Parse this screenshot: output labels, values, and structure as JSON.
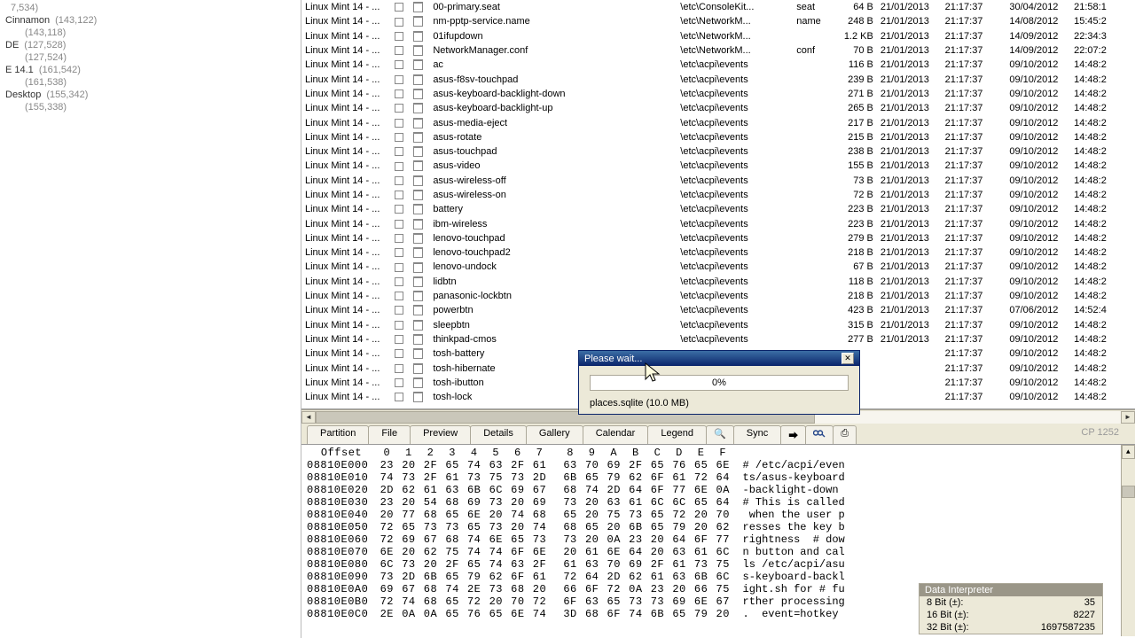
{
  "sidebar": {
    "items": [
      {
        "label": "",
        "count": "7,534)"
      },
      {
        "label": "Cinnamon",
        "count": "(143,122)"
      },
      {
        "label": "",
        "count": "(143,118)",
        "indent": true
      },
      {
        "label": "DE",
        "count": "(127,528)"
      },
      {
        "label": "",
        "count": "(127,524)",
        "indent": true
      },
      {
        "label": "E 14.1",
        "count": "(161,542)"
      },
      {
        "label": "",
        "count": "(161,538)",
        "indent": true
      },
      {
        "label": "Desktop",
        "count": "(155,342)"
      },
      {
        "label": "",
        "count": "(155,338)",
        "indent": true
      }
    ]
  },
  "grid": {
    "rows": [
      {
        "desc": "Linux Mint 14 - ...",
        "name": "00-primary.seat",
        "path": "\\etc\\ConsoleKit...",
        "ext": "seat",
        "size": "64 B",
        "d1": "21/01/2013",
        "t1": "21:17:37",
        "d2": "30/04/2012",
        "t2": "21:58:1"
      },
      {
        "desc": "Linux Mint 14 - ...",
        "name": "nm-pptp-service.name",
        "path": "\\etc\\NetworkM...",
        "ext": "name",
        "size": "248 B",
        "d1": "21/01/2013",
        "t1": "21:17:37",
        "d2": "14/08/2012",
        "t2": "15:45:2"
      },
      {
        "desc": "Linux Mint 14 - ...",
        "name": "01ifupdown",
        "path": "\\etc\\NetworkM...",
        "ext": "",
        "size": "1.2 KB",
        "d1": "21/01/2013",
        "t1": "21:17:37",
        "d2": "14/09/2012",
        "t2": "22:34:3"
      },
      {
        "desc": "Linux Mint 14 - ...",
        "name": "NetworkManager.conf",
        "path": "\\etc\\NetworkM...",
        "ext": "conf",
        "size": "70 B",
        "d1": "21/01/2013",
        "t1": "21:17:37",
        "d2": "14/09/2012",
        "t2": "22:07:2"
      },
      {
        "desc": "Linux Mint 14 - ...",
        "name": "ac",
        "path": "\\etc\\acpi\\events",
        "ext": "",
        "size": "116 B",
        "d1": "21/01/2013",
        "t1": "21:17:37",
        "d2": "09/10/2012",
        "t2": "14:48:2"
      },
      {
        "desc": "Linux Mint 14 - ...",
        "name": "asus-f8sv-touchpad",
        "path": "\\etc\\acpi\\events",
        "ext": "",
        "size": "239 B",
        "d1": "21/01/2013",
        "t1": "21:17:37",
        "d2": "09/10/2012",
        "t2": "14:48:2"
      },
      {
        "desc": "Linux Mint 14 - ...",
        "name": "asus-keyboard-backlight-down",
        "path": "\\etc\\acpi\\events",
        "ext": "",
        "size": "271 B",
        "d1": "21/01/2013",
        "t1": "21:17:37",
        "d2": "09/10/2012",
        "t2": "14:48:2"
      },
      {
        "desc": "Linux Mint 14 - ...",
        "name": "asus-keyboard-backlight-up",
        "path": "\\etc\\acpi\\events",
        "ext": "",
        "size": "265 B",
        "d1": "21/01/2013",
        "t1": "21:17:37",
        "d2": "09/10/2012",
        "t2": "14:48:2"
      },
      {
        "desc": "Linux Mint 14 - ...",
        "name": "asus-media-eject",
        "path": "\\etc\\acpi\\events",
        "ext": "",
        "size": "217 B",
        "d1": "21/01/2013",
        "t1": "21:17:37",
        "d2": "09/10/2012",
        "t2": "14:48:2"
      },
      {
        "desc": "Linux Mint 14 - ...",
        "name": "asus-rotate",
        "path": "\\etc\\acpi\\events",
        "ext": "",
        "size": "215 B",
        "d1": "21/01/2013",
        "t1": "21:17:37",
        "d2": "09/10/2012",
        "t2": "14:48:2"
      },
      {
        "desc": "Linux Mint 14 - ...",
        "name": "asus-touchpad",
        "path": "\\etc\\acpi\\events",
        "ext": "",
        "size": "238 B",
        "d1": "21/01/2013",
        "t1": "21:17:37",
        "d2": "09/10/2012",
        "t2": "14:48:2"
      },
      {
        "desc": "Linux Mint 14 - ...",
        "name": "asus-video",
        "path": "\\etc\\acpi\\events",
        "ext": "",
        "size": "155 B",
        "d1": "21/01/2013",
        "t1": "21:17:37",
        "d2": "09/10/2012",
        "t2": "14:48:2"
      },
      {
        "desc": "Linux Mint 14 - ...",
        "name": "asus-wireless-off",
        "path": "\\etc\\acpi\\events",
        "ext": "",
        "size": "73 B",
        "d1": "21/01/2013",
        "t1": "21:17:37",
        "d2": "09/10/2012",
        "t2": "14:48:2"
      },
      {
        "desc": "Linux Mint 14 - ...",
        "name": "asus-wireless-on",
        "path": "\\etc\\acpi\\events",
        "ext": "",
        "size": "72 B",
        "d1": "21/01/2013",
        "t1": "21:17:37",
        "d2": "09/10/2012",
        "t2": "14:48:2"
      },
      {
        "desc": "Linux Mint 14 - ...",
        "name": "battery",
        "path": "\\etc\\acpi\\events",
        "ext": "",
        "size": "223 B",
        "d1": "21/01/2013",
        "t1": "21:17:37",
        "d2": "09/10/2012",
        "t2": "14:48:2"
      },
      {
        "desc": "Linux Mint 14 - ...",
        "name": "ibm-wireless",
        "path": "\\etc\\acpi\\events",
        "ext": "",
        "size": "223 B",
        "d1": "21/01/2013",
        "t1": "21:17:37",
        "d2": "09/10/2012",
        "t2": "14:48:2"
      },
      {
        "desc": "Linux Mint 14 - ...",
        "name": "lenovo-touchpad",
        "path": "\\etc\\acpi\\events",
        "ext": "",
        "size": "279 B",
        "d1": "21/01/2013",
        "t1": "21:17:37",
        "d2": "09/10/2012",
        "t2": "14:48:2"
      },
      {
        "desc": "Linux Mint 14 - ...",
        "name": "lenovo-touchpad2",
        "path": "\\etc\\acpi\\events",
        "ext": "",
        "size": "218 B",
        "d1": "21/01/2013",
        "t1": "21:17:37",
        "d2": "09/10/2012",
        "t2": "14:48:2"
      },
      {
        "desc": "Linux Mint 14 - ...",
        "name": "lenovo-undock",
        "path": "\\etc\\acpi\\events",
        "ext": "",
        "size": "67 B",
        "d1": "21/01/2013",
        "t1": "21:17:37",
        "d2": "09/10/2012",
        "t2": "14:48:2"
      },
      {
        "desc": "Linux Mint 14 - ...",
        "name": "lidbtn",
        "path": "\\etc\\acpi\\events",
        "ext": "",
        "size": "118 B",
        "d1": "21/01/2013",
        "t1": "21:17:37",
        "d2": "09/10/2012",
        "t2": "14:48:2"
      },
      {
        "desc": "Linux Mint 14 - ...",
        "name": "panasonic-lockbtn",
        "path": "\\etc\\acpi\\events",
        "ext": "",
        "size": "218 B",
        "d1": "21/01/2013",
        "t1": "21:17:37",
        "d2": "09/10/2012",
        "t2": "14:48:2"
      },
      {
        "desc": "Linux Mint 14 - ...",
        "name": "powerbtn",
        "path": "\\etc\\acpi\\events",
        "ext": "",
        "size": "423 B",
        "d1": "21/01/2013",
        "t1": "21:17:37",
        "d2": "07/06/2012",
        "t2": "14:52:4"
      },
      {
        "desc": "Linux Mint 14 - ...",
        "name": "sleepbtn",
        "path": "\\etc\\acpi\\events",
        "ext": "",
        "size": "315 B",
        "d1": "21/01/2013",
        "t1": "21:17:37",
        "d2": "09/10/2012",
        "t2": "14:48:2"
      },
      {
        "desc": "Linux Mint 14 - ...",
        "name": "thinkpad-cmos",
        "path": "\\etc\\acpi\\events",
        "ext": "",
        "size": "277 B",
        "d1": "21/01/2013",
        "t1": "21:17:37",
        "d2": "09/10/2012",
        "t2": "14:48:2"
      },
      {
        "desc": "Linux Mint 14 - ...",
        "name": "tosh-battery",
        "path": "",
        "ext": "",
        "size": "",
        "d1": "",
        "t1": "21:17:37",
        "d2": "09/10/2012",
        "t2": "14:48:2"
      },
      {
        "desc": "Linux Mint 14 - ...",
        "name": "tosh-hibernate",
        "path": "",
        "ext": "",
        "size": "",
        "d1": "",
        "t1": "21:17:37",
        "d2": "09/10/2012",
        "t2": "14:48:2"
      },
      {
        "desc": "Linux Mint 14 - ...",
        "name": "tosh-ibutton",
        "path": "",
        "ext": "",
        "size": "",
        "d1": "",
        "t1": "21:17:37",
        "d2": "09/10/2012",
        "t2": "14:48:2"
      },
      {
        "desc": "Linux Mint 14 - ...",
        "name": "tosh-lock",
        "path": "",
        "ext": "",
        "size": "",
        "d1": "",
        "t1": "21:17:37",
        "d2": "09/10/2012",
        "t2": "14:48:2"
      }
    ]
  },
  "tabs": {
    "items": [
      "Partition",
      "File",
      "Preview",
      "Details",
      "Gallery",
      "Calendar",
      "Legend"
    ],
    "sync_label": "Sync",
    "codepage": "CP 1252"
  },
  "hex": {
    "header_offset": "Offset",
    "cols": [
      "0",
      "1",
      "2",
      "3",
      "4",
      "5",
      "6",
      "7",
      "8",
      "9",
      "A",
      "B",
      "C",
      "D",
      "E",
      "F"
    ],
    "rows": [
      {
        "off": "08810E000",
        "b": [
          "23",
          "20",
          "2F",
          "65",
          "74",
          "63",
          "2F",
          "61",
          "63",
          "70",
          "69",
          "2F",
          "65",
          "76",
          "65",
          "6E"
        ],
        "a": "# /etc/acpi/even"
      },
      {
        "off": "08810E010",
        "b": [
          "74",
          "73",
          "2F",
          "61",
          "73",
          "75",
          "73",
          "2D",
          "6B",
          "65",
          "79",
          "62",
          "6F",
          "61",
          "72",
          "64"
        ],
        "a": "ts/asus-keyboard"
      },
      {
        "off": "08810E020",
        "b": [
          "2D",
          "62",
          "61",
          "63",
          "6B",
          "6C",
          "69",
          "67",
          "68",
          "74",
          "2D",
          "64",
          "6F",
          "77",
          "6E",
          "0A"
        ],
        "a": "-backlight-down "
      },
      {
        "off": "08810E030",
        "b": [
          "23",
          "20",
          "54",
          "68",
          "69",
          "73",
          "20",
          "69",
          "73",
          "20",
          "63",
          "61",
          "6C",
          "6C",
          "65",
          "64"
        ],
        "a": "# This is called"
      },
      {
        "off": "08810E040",
        "b": [
          "20",
          "77",
          "68",
          "65",
          "6E",
          "20",
          "74",
          "68",
          "65",
          "20",
          "75",
          "73",
          "65",
          "72",
          "20",
          "70"
        ],
        "a": " when the user p"
      },
      {
        "off": "08810E050",
        "b": [
          "72",
          "65",
          "73",
          "73",
          "65",
          "73",
          "20",
          "74",
          "68",
          "65",
          "20",
          "6B",
          "65",
          "79",
          "20",
          "62"
        ],
        "a": "resses the key b"
      },
      {
        "off": "08810E060",
        "b": [
          "72",
          "69",
          "67",
          "68",
          "74",
          "6E",
          "65",
          "73",
          "73",
          "20",
          "0A",
          "23",
          "20",
          "64",
          "6F",
          "77"
        ],
        "a": "rightness  # dow"
      },
      {
        "off": "08810E070",
        "b": [
          "6E",
          "20",
          "62",
          "75",
          "74",
          "74",
          "6F",
          "6E",
          "20",
          "61",
          "6E",
          "64",
          "20",
          "63",
          "61",
          "6C"
        ],
        "a": "n button and cal"
      },
      {
        "off": "08810E080",
        "b": [
          "6C",
          "73",
          "20",
          "2F",
          "65",
          "74",
          "63",
          "2F",
          "61",
          "63",
          "70",
          "69",
          "2F",
          "61",
          "73",
          "75"
        ],
        "a": "ls /etc/acpi/asu"
      },
      {
        "off": "08810E090",
        "b": [
          "73",
          "2D",
          "6B",
          "65",
          "79",
          "62",
          "6F",
          "61",
          "72",
          "64",
          "2D",
          "62",
          "61",
          "63",
          "6B",
          "6C"
        ],
        "a": "s-keyboard-backl"
      },
      {
        "off": "08810E0A0",
        "b": [
          "69",
          "67",
          "68",
          "74",
          "2E",
          "73",
          "68",
          "20",
          "66",
          "6F",
          "72",
          "0A",
          "23",
          "20",
          "66",
          "75"
        ],
        "a": "ight.sh for # fu"
      },
      {
        "off": "08810E0B0",
        "b": [
          "72",
          "74",
          "68",
          "65",
          "72",
          "20",
          "70",
          "72",
          "6F",
          "63",
          "65",
          "73",
          "73",
          "69",
          "6E",
          "67"
        ],
        "a": "rther processing"
      },
      {
        "off": "08810E0C0",
        "b": [
          "2E",
          "0A",
          "0A",
          "65",
          "76",
          "65",
          "6E",
          "74",
          "3D",
          "68",
          "6F",
          "74",
          "6B",
          "65",
          "79",
          "20"
        ],
        "a": ".  event=hotkey "
      }
    ]
  },
  "dialog": {
    "title": "Please wait...",
    "percent": "0%",
    "status": "places.sqlite (10.0 MB)"
  },
  "di": {
    "title": "Data Interpreter",
    "rows": [
      {
        "k": "8 Bit (±):",
        "v": "35"
      },
      {
        "k": "16 Bit (±):",
        "v": "8227"
      },
      {
        "k": "32 Bit (±):",
        "v": "1697587235"
      }
    ]
  }
}
